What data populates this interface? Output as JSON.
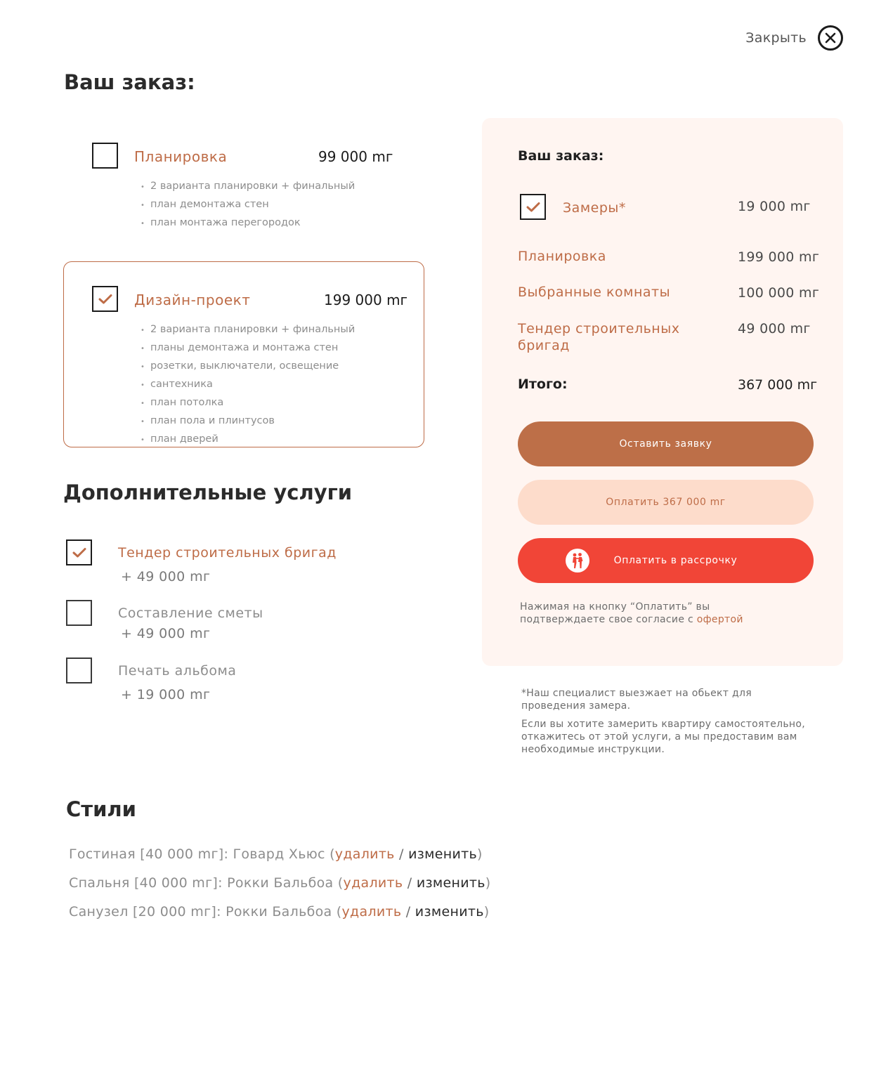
{
  "header": {
    "close_label": "Закрыть"
  },
  "order": {
    "title": "Ваш заказ:",
    "packages": [
      {
        "title": "Планировка",
        "price": "99 000 mг",
        "checked": false,
        "features": [
          "2 варианта планировки + финальный",
          "план демонтажа стен",
          "план монтажа перегородок"
        ]
      },
      {
        "title": "Дизайн-проект",
        "price": "199 000 mг",
        "checked": true,
        "features": [
          "2 варианта планировки + финальный",
          "планы демонтажа и монтажа стен",
          "розетки, выключатели, освещение",
          "сантехника",
          "план потолка",
          "план пола и плинтусов",
          "план дверей"
        ]
      }
    ]
  },
  "extras": {
    "title": "Дополнительные услуги",
    "items": [
      {
        "title": "Тендер строительных бригад",
        "price": "+ 49 000 mг",
        "checked": true
      },
      {
        "title": "Составление сметы",
        "price": "+ 49 000 mг",
        "checked": false
      },
      {
        "title": "Печать альбома",
        "price": "+ 19 000 mг",
        "checked": false
      }
    ]
  },
  "summary": {
    "title": "Ваш заказ:",
    "measure": {
      "label": "Замеры*",
      "price": "19 000 mг",
      "checked": true
    },
    "rows": [
      {
        "label": "Планировка",
        "price": "199 000 mг"
      },
      {
        "label": "Выбранные комнаты",
        "price": "100 000 mг"
      },
      {
        "label": "Тендер строительных бригад",
        "price": "49 000 mг"
      }
    ],
    "total_label": "Итого:",
    "total_value": "367 000 mг",
    "btn_request": "Оставить заявку",
    "btn_pay": "Оплатить 367 000 mг",
    "btn_installment": "Оплатить в рассрочку",
    "consent_text": "Нажимая на кнопку “Оплатить” вы подтверждаете свое согласие с",
    "consent_link": "офертой"
  },
  "footnote": {
    "p1": "*Наш специалист выезжает на обьект для проведения замера.",
    "p2": "Если вы хотите замерить квартиру самостоятельно, откажитесь от этой услуги, а мы предоставим вам необходимые инструкции."
  },
  "styles": {
    "title": "Стили",
    "items": [
      {
        "text": "Гостиная [40 000 mг]: Говард Хьюс (",
        "delete": "удалить",
        "sep": " / ",
        "edit": "изменить",
        "close": ")"
      },
      {
        "text": "Спальня [40 000 mг]: Рокки Бальбоа (",
        "delete": "удалить",
        "sep": " / ",
        "edit": "изменить",
        "close": ")"
      },
      {
        "text": "Санузел [20 000 mг]: Рокки Бальбоа (",
        "delete": "удалить",
        "sep": " / ",
        "edit": "изменить",
        "close": ")"
      }
    ]
  },
  "colors": {
    "accent": "#be6c47",
    "panel_bg": "#fff5f1",
    "primary_btn": "#bd6f48",
    "pay_btn": "#fddccb",
    "installment_btn": "#f14537"
  }
}
